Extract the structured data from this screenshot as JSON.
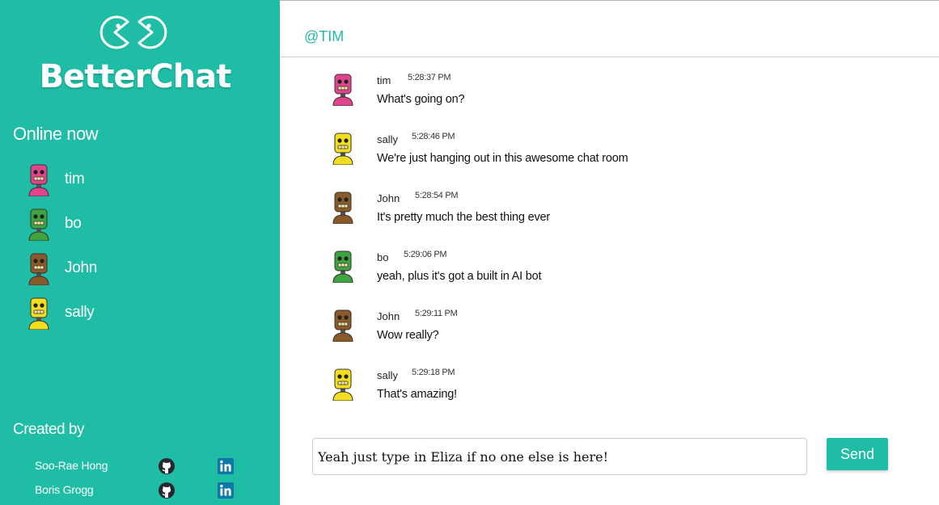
{
  "brand": {
    "name": "BetterChat"
  },
  "sidebar": {
    "online_title": "Online now",
    "users": [
      {
        "name": "tim",
        "color": "#e0448f"
      },
      {
        "name": "bo",
        "color": "#3fa33f"
      },
      {
        "name": "John",
        "color": "#8a5a2b"
      },
      {
        "name": "sally",
        "color": "#f2de1e"
      }
    ],
    "created_title": "Created by",
    "creators": [
      {
        "name": "Soo-Rae Hong",
        "github_icon": "github-icon",
        "linkedin_icon": "linkedin-icon"
      },
      {
        "name": "Boris Grogg",
        "github_icon": "github-icon",
        "linkedin_icon": "linkedin-icon"
      }
    ]
  },
  "chat": {
    "room": "@TIM",
    "messages": [
      {
        "author": "tim",
        "time": "5:28:37 PM",
        "text": "What's going on?",
        "color": "#e0448f"
      },
      {
        "author": "sally",
        "time": "5:28:46 PM",
        "text": "We're just hanging out in this awesome chat room",
        "color": "#f2de1e"
      },
      {
        "author": "John",
        "time": "5:28:54 PM",
        "text": "It's pretty much the best thing ever",
        "color": "#8a5a2b"
      },
      {
        "author": "bo",
        "time": "5:29:06 PM",
        "text": "yeah, plus it's got a built in AI bot",
        "color": "#3fa33f"
      },
      {
        "author": "John",
        "time": "5:29:11 PM",
        "text": "Wow really?",
        "color": "#8a5a2b"
      },
      {
        "author": "sally",
        "time": "5:29:18 PM",
        "text": "That's amazing!",
        "color": "#f2de1e"
      }
    ],
    "input_value": "Yeah just type in Eliza if no one else is here!",
    "send_label": "Send"
  },
  "colors": {
    "accent": "#1fbda6"
  }
}
